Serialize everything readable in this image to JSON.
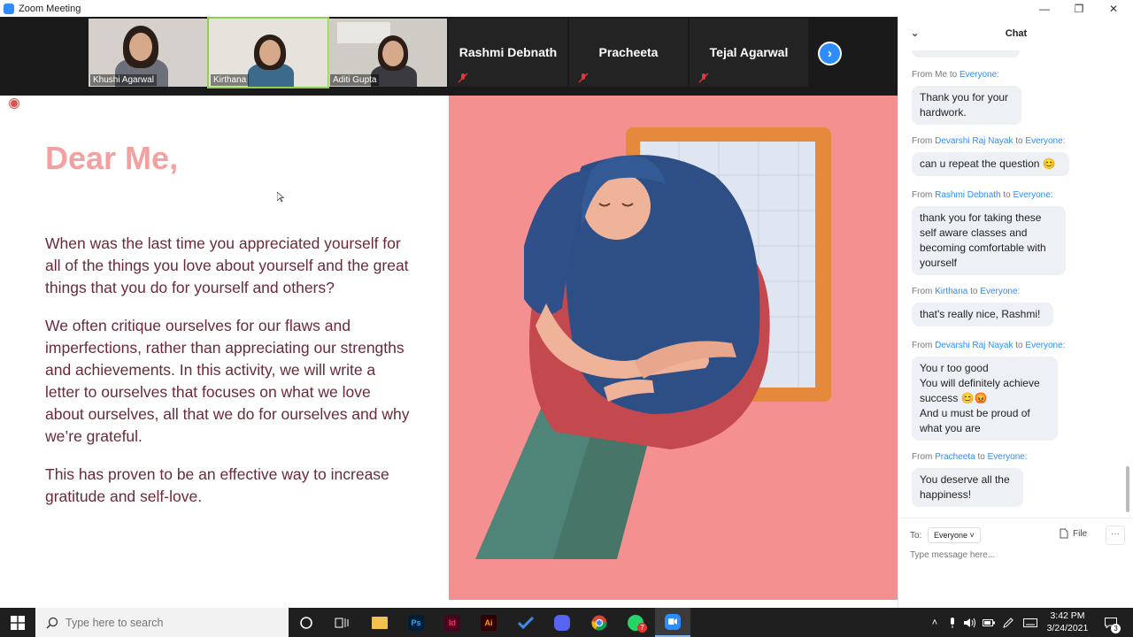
{
  "window": {
    "title": "Zoom Meeting"
  },
  "participants": [
    {
      "name": "Khushi Agarwal",
      "video": true
    },
    {
      "name": "Kirthana",
      "video": true,
      "active": true
    },
    {
      "name": "Aditi Gupta",
      "video": true
    },
    {
      "name": "Rashmi Debnath",
      "video": false,
      "muted": true
    },
    {
      "name": "Pracheeta",
      "video": false,
      "muted": true
    },
    {
      "name": "Tejal Agarwal",
      "video": false,
      "muted": true
    }
  ],
  "slide": {
    "heading": "Dear Me,",
    "paragraphs": [
      "When was the last time you appreciated yourself for all of the things you love about yourself and the great things that you do for yourself and others?",
      "We often critique ourselves  for our flaws and imperfections, rather than appreciating our strengths and achievements. In this activity, we will write a letter to ourselves that focuses on what we love about ourselves, all that we do for ourselves and why we’re grateful.",
      "This has proven to be an effective way to increase gratitude and self-love."
    ],
    "colors": {
      "heading": "#f2a1a0",
      "body": "#6b2a38",
      "illustration_bg": "#f4908f"
    }
  },
  "chat": {
    "title": "Chat",
    "messages": [
      {
        "from": "Me",
        "to": "Everyone:",
        "text": "Thank you for your hardwork."
      },
      {
        "from": "Devarshi Raj Nayak",
        "to": "Everyone:",
        "text": "can u repeat the question 😊"
      },
      {
        "from": "Rashmi Debnath",
        "to": "Everyone:",
        "text": "thank you for taking these self aware classes and becoming comfortable with yourself"
      },
      {
        "from": "Kirthana",
        "to": "Everyone:",
        "text": "that's really nice, Rashmi!"
      },
      {
        "from": "Devarshi Raj Nayak",
        "to": "Everyone:",
        "text": "You r too good\nYou will definitely achieve success 😊😡\nAnd u must be proud of what you are"
      },
      {
        "from": "Pracheeta",
        "to": "Everyone:",
        "text": "You deserve all the happiness!"
      }
    ],
    "from_prefix": "From",
    "to_word": "to",
    "to_label": "To:",
    "to_value": "Everyone",
    "file_label": "File",
    "more_label": "···",
    "input_placeholder": "Type message here..."
  },
  "taskbar": {
    "search_placeholder": "Type here to search",
    "apps": [
      "cortana",
      "task-view",
      "file-explorer",
      "photoshop",
      "indesign",
      "illustrator",
      "todo",
      "discord",
      "chrome",
      "whatsapp",
      "zoom"
    ],
    "whatsapp_badge": "7",
    "notification_badge": "3",
    "time": "3:42 PM",
    "date": "3/24/2021"
  }
}
